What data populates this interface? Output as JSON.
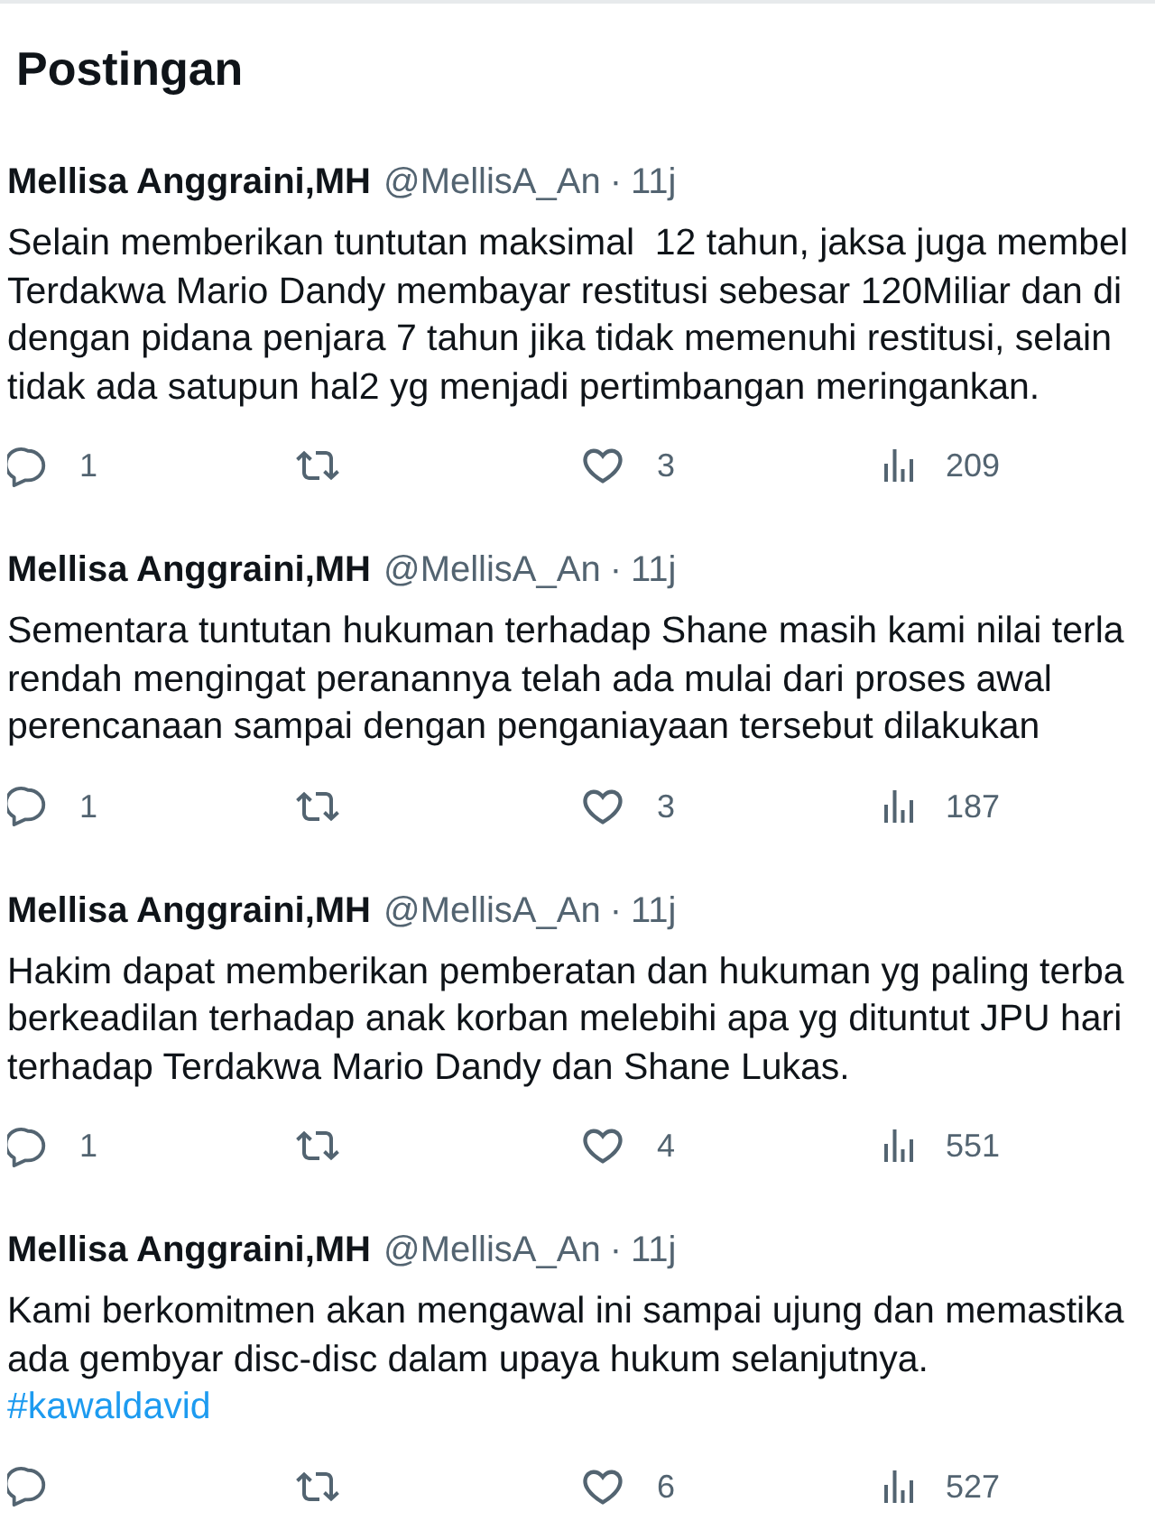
{
  "header": {
    "title": "Postingan"
  },
  "posts": [
    {
      "author": "Mellisa Anggraini,MH",
      "handle": "@MellisA_An",
      "separator": "·",
      "time": "11j",
      "lines": [
        "Selain memberikan tuntutan maksimal  12 tahun, jaksa juga membel",
        "Terdakwa Mario Dandy membayar restitusi sebesar 120Miliar dan di",
        "dengan pidana penjara 7 tahun jika tidak memenuhi restitusi, selain",
        "tidak ada satupun hal2 yg menjadi pertimbangan meringankan."
      ],
      "actions": [
        {
          "kind": "reply",
          "count": "1"
        },
        {
          "kind": "repost"
        },
        {
          "kind": "like",
          "count": "3"
        },
        {
          "kind": "views",
          "count": "209"
        }
      ]
    },
    {
      "author": "Mellisa Anggraini,MH",
      "handle": "@MellisA_An",
      "separator": "·",
      "time": "11j",
      "lines": [
        "Sementara tuntutan hukuman terhadap Shane masih kami nilai terla",
        "rendah mengingat peranannya telah ada mulai dari proses awal",
        "perencanaan sampai dengan penganiayaan tersebut dilakukan"
      ],
      "actions": [
        {
          "kind": "reply",
          "count": "1"
        },
        {
          "kind": "repost"
        },
        {
          "kind": "like",
          "count": "3"
        },
        {
          "kind": "views",
          "count": "187"
        }
      ]
    },
    {
      "author": "Mellisa Anggraini,MH",
      "handle": "@MellisA_An",
      "separator": "·",
      "time": "11j",
      "lines": [
        "Hakim dapat memberikan pemberatan dan hukuman yg paling terba",
        "berkeadilan terhadap anak korban melebihi apa yg dituntut JPU hari",
        "terhadap Terdakwa Mario Dandy dan Shane Lukas."
      ],
      "actions": [
        {
          "kind": "reply",
          "count": "1"
        },
        {
          "kind": "repost"
        },
        {
          "kind": "like",
          "count": "4"
        },
        {
          "kind": "views",
          "count": "551"
        }
      ]
    },
    {
      "author": "Mellisa Anggraini,MH",
      "handle": "@MellisA_An",
      "separator": "·",
      "time": "11j",
      "lines": [
        "Kami berkomitmen akan mengawal ini sampai ujung dan memastika",
        "ada gembyar disc-disc dalam upaya hukum selanjutnya."
      ],
      "hashtags": [
        "#kawaldavid"
      ],
      "actions": [
        {
          "kind": "reply"
        },
        {
          "kind": "repost"
        },
        {
          "kind": "like",
          "count": "6"
        },
        {
          "kind": "views",
          "count": "527"
        }
      ]
    }
  ]
}
